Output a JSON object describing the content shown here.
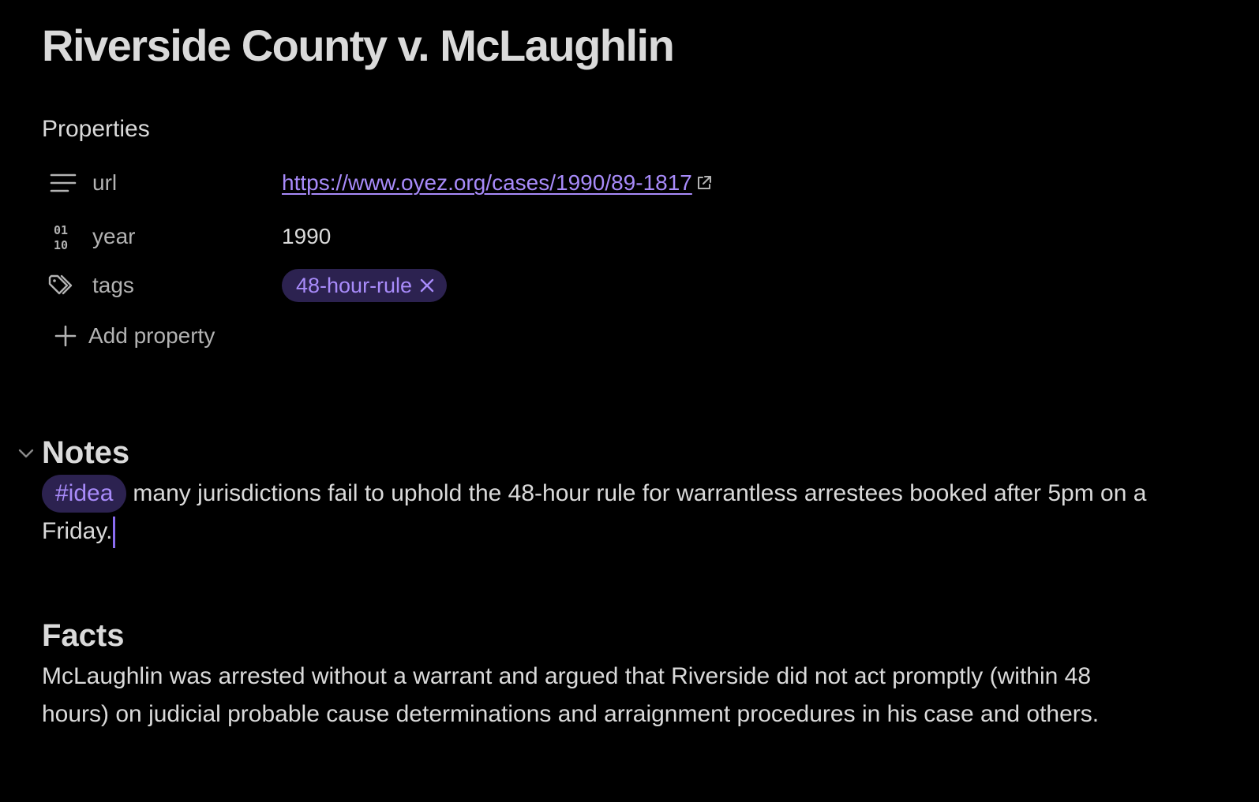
{
  "page": {
    "title": "Riverside County v. McLaughlin"
  },
  "properties": {
    "heading": "Properties",
    "items": [
      {
        "icon": "text-lines-icon",
        "name": "url",
        "value": "https://www.oyez.org/cases/1990/89-1817"
      },
      {
        "icon": "number-icon",
        "name": "year",
        "value": "1990"
      },
      {
        "icon": "tags-icon",
        "name": "tags",
        "value": "48-hour-rule"
      }
    ],
    "add_label": "Add property"
  },
  "notes": {
    "heading": "Notes",
    "hashtag": "#idea",
    "text": "many jurisdictions fail to uphold the 48-hour rule for warrantless arrestees booked after 5pm on a Friday."
  },
  "facts": {
    "heading": "Facts",
    "text": "McLaughlin was arrested without a warrant and argued that Riverside did not act promptly (within 48 hours) on judicial probable cause determinations and arraignment procedures in his case and others."
  },
  "colors": {
    "background": "#000000",
    "text": "#dadada",
    "muted": "#b3b3b3",
    "accent": "#a88bfa",
    "pill_background": "#2c2250"
  }
}
